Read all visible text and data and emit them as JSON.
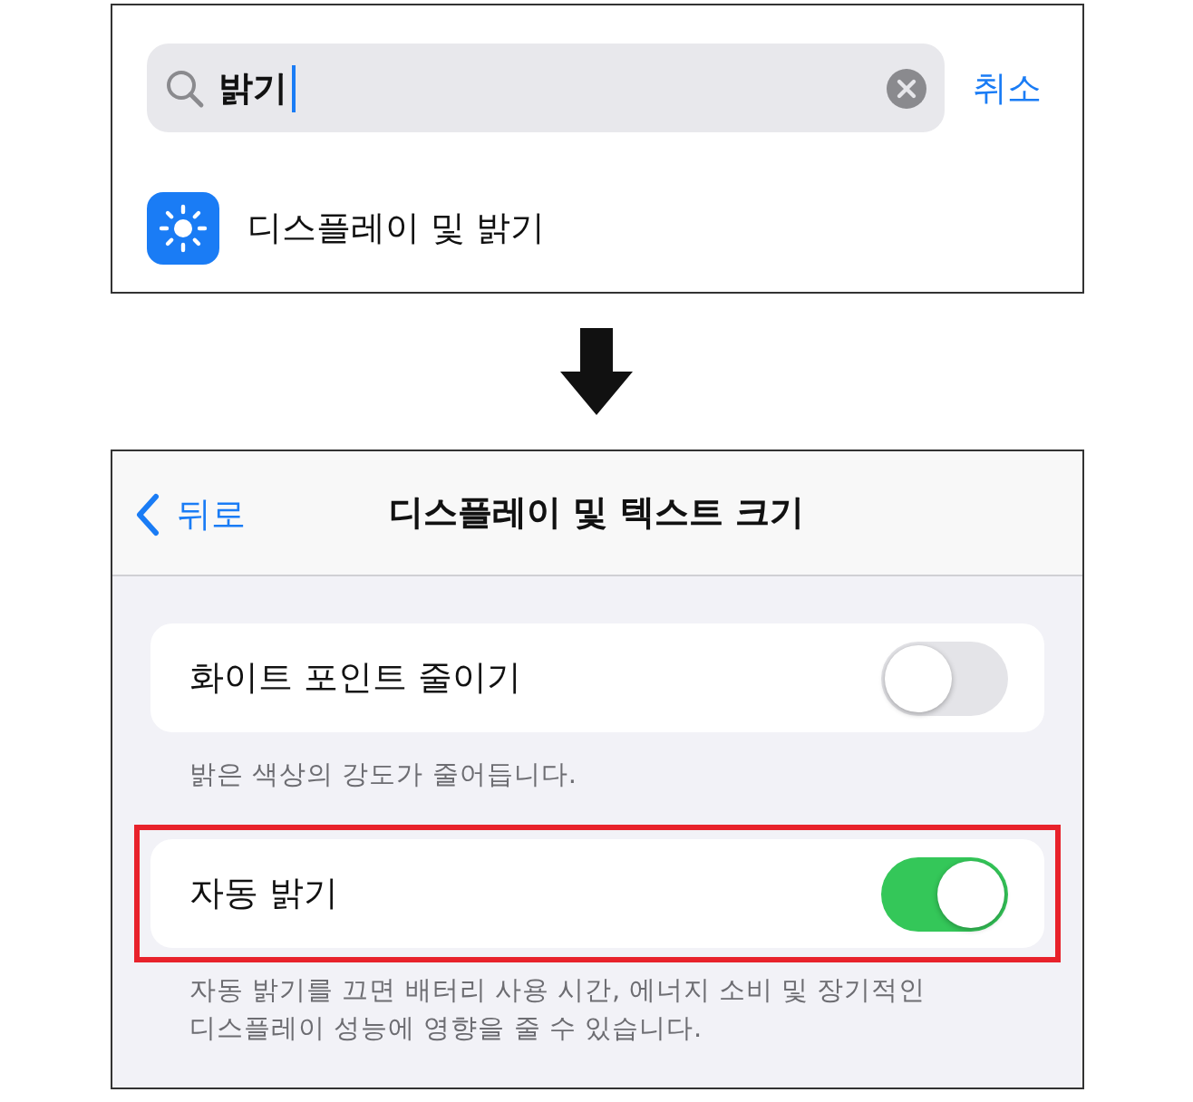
{
  "search": {
    "value": "밝기",
    "cancel": "취소"
  },
  "results": [
    {
      "label": "디스플레이 및 밝기"
    }
  ],
  "nav": {
    "back": "뒤로",
    "title": "디스플레이 및 텍스트 크기"
  },
  "settings": [
    {
      "label": "화이트 포인트 줄이기",
      "on": false,
      "highlighted": false,
      "footer": "밝은 색상의 강도가 줄어듭니다."
    },
    {
      "label": "자동 밝기",
      "on": true,
      "highlighted": true,
      "footer": "자동 밝기를 끄면 배터리 사용 시간, 에너지 소비 및 장기적인 디스플레이 성능에 영향을 줄 수 있습니다."
    }
  ]
}
